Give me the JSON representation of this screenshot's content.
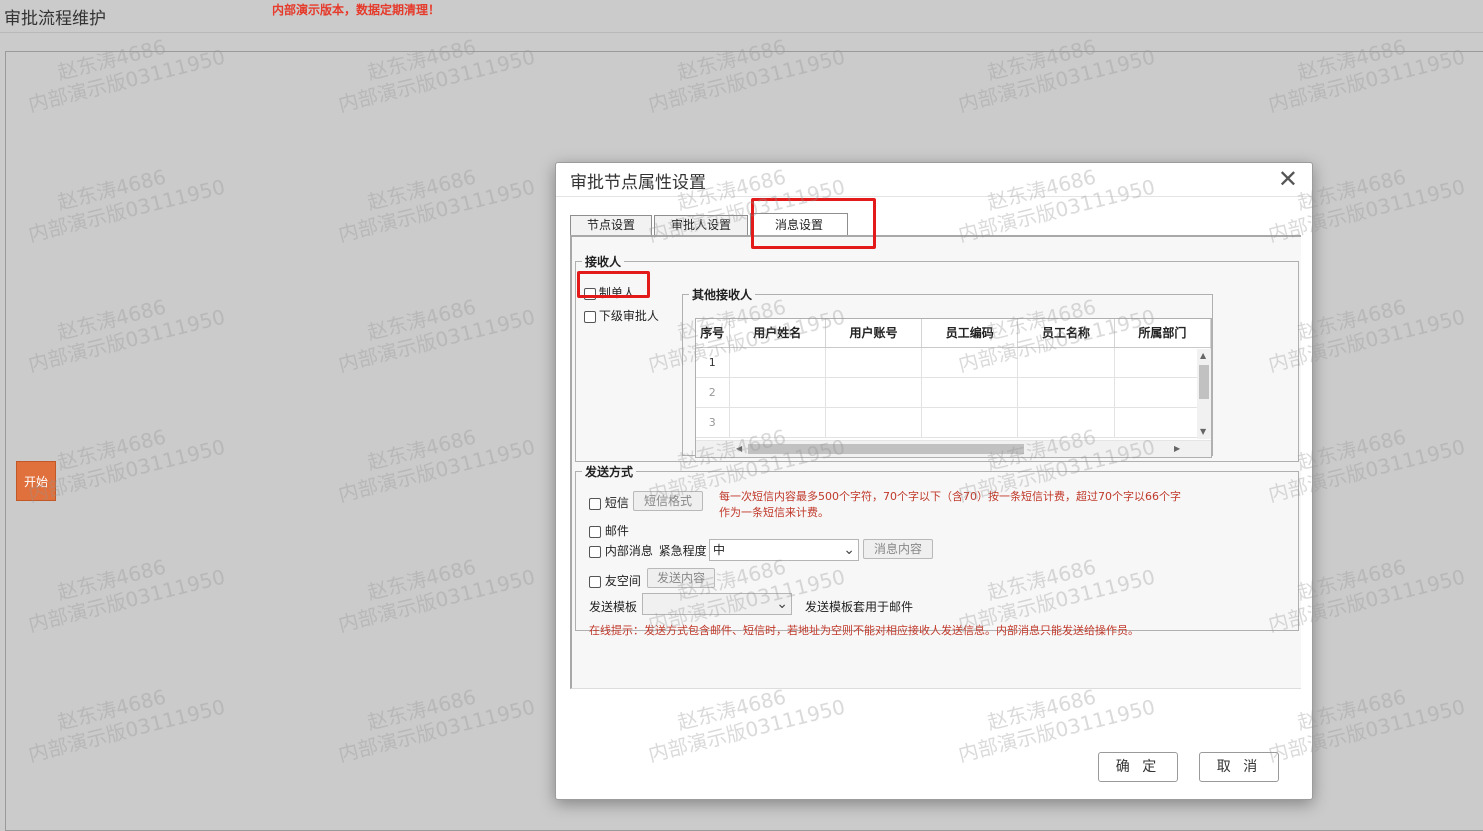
{
  "page": {
    "title": "审批流程维护",
    "notice": "内部演示版本，数据定期清理！"
  },
  "canvas": {
    "start_node": "开始"
  },
  "watermark": {
    "line1": "赵东涛4686",
    "line2": "内部演示版03111950"
  },
  "dialog": {
    "title": "审批节点属性设置",
    "close": "✕",
    "tabs": [
      {
        "label": "节点设置",
        "active": false
      },
      {
        "label": "审批人设置",
        "active": false
      },
      {
        "label": "消息设置",
        "active": true
      }
    ],
    "recipients": {
      "legend": "接收人",
      "creator_label": "制单人",
      "next_approver_label": "下级审批人",
      "other": {
        "legend": "其他接收人",
        "columns": [
          "序号",
          "用户姓名",
          "用户账号",
          "员工编码",
          "员工名称",
          "所属部门"
        ],
        "rows": [
          "1",
          "2",
          "3"
        ]
      }
    },
    "send_method": {
      "legend": "发送方式",
      "sms_label": "短信",
      "sms_format_button": "短信格式",
      "sms_note_line1": "每一次短信内容最多500个字符，70个字以下（含70）按一条短信计费，超过70个字以66个字",
      "sms_note_line2": "作为一条短信来计费。",
      "email_label": "邮件",
      "internal_label": "内部消息",
      "urgency_label": "紧急程度",
      "urgency_value": "中",
      "message_content_button": "消息内容",
      "friend_space_label": "友空间",
      "send_content_button": "发送内容",
      "template_label": "发送模板",
      "template_value": "",
      "template_note": "发送模板套用于邮件",
      "hint": "在线提示：发送方式包含邮件、短信时，若地址为空则不能对相应接收人发送信息。内部消息只能发送给操作员。"
    },
    "ok_button": "确 定",
    "cancel_button": "取 消"
  },
  "colors": {
    "accent_red": "#e21a1a",
    "note_text": "#c0392b",
    "start_node": "#e0703c"
  }
}
